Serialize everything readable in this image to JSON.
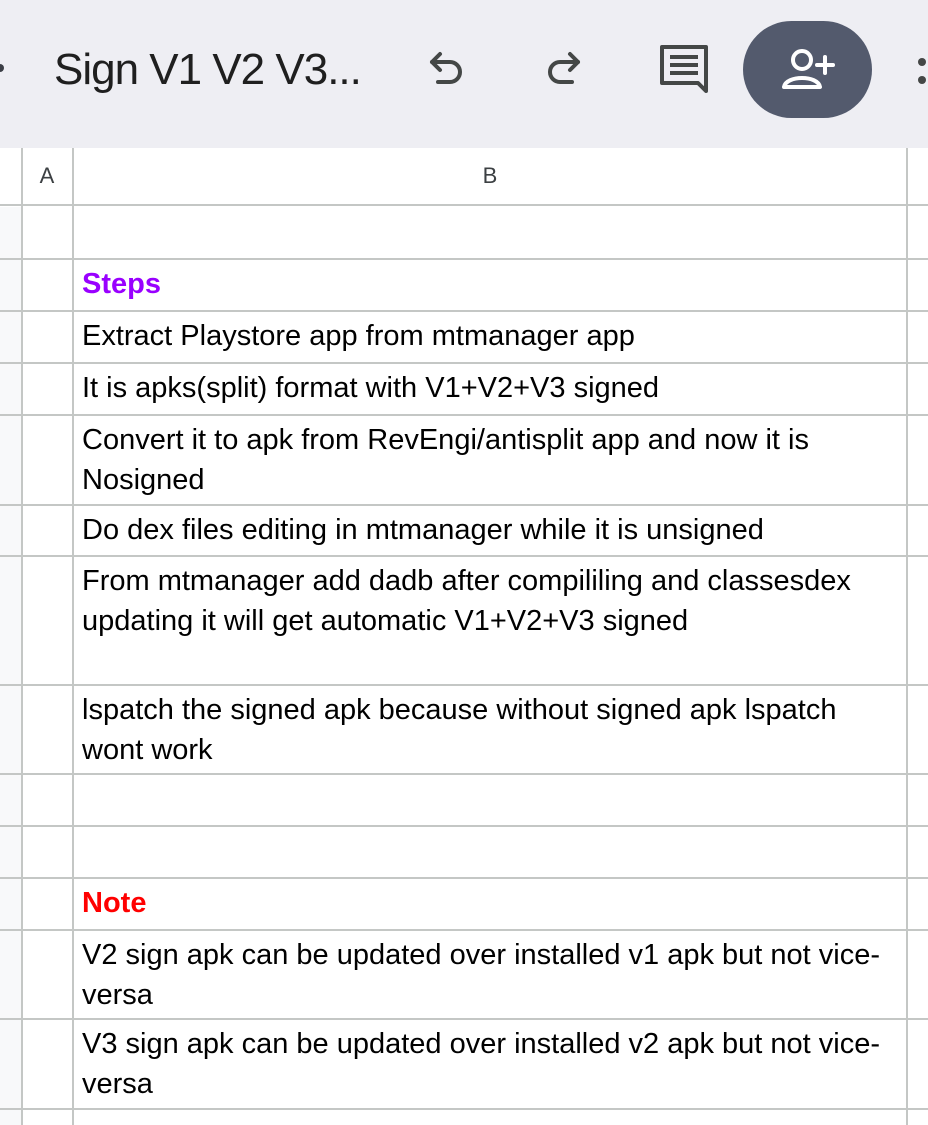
{
  "toolbar": {
    "title": "Sign V1 V2 V3...",
    "undo_icon": "undo-icon",
    "redo_icon": "redo-icon",
    "comment_icon": "comment-icon",
    "share_icon": "add-person-icon",
    "share_button_color": "#535a6d",
    "more_icon": "more-vert-icon",
    "background": "#eeeef3"
  },
  "sheet": {
    "columns": [
      "A",
      "B"
    ],
    "rows": [
      {
        "text": ""
      },
      {
        "text": "Steps",
        "style": "heading",
        "color": "#9900ff"
      },
      {
        "text": "Extract Playstore app from mtmanager app"
      },
      {
        "text": "It is apks(split) format with V1+V2+V3 signed"
      },
      {
        "text": "Convert it to apk from RevEngi/antisplit app and now it is Nosigned"
      },
      {
        "text": "Do dex files editing in mtmanager while it is unsigned"
      },
      {
        "text": "From mtmanager add dadb after compililing and classesdex updating it will get automatic V1+V2+V3 signed"
      },
      {
        "text": "lspatch the signed apk because without signed apk lspatch wont work"
      },
      {
        "text": ""
      },
      {
        "text": ""
      },
      {
        "text": "Note",
        "style": "heading",
        "color": "#ff0000"
      },
      {
        "text": "V2 sign apk can be updated over installed v1 apk but not vice-versa"
      },
      {
        "text": "V3 sign apk can be updated over installed v2 apk but not vice-versa"
      }
    ]
  }
}
